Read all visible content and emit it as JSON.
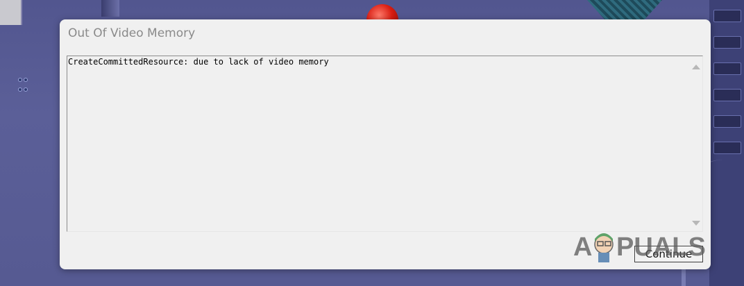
{
  "dialog": {
    "title": "Out Of Video Memory",
    "message": "CreateCommittedResource: due to lack of video memory",
    "continue_label": "Continue"
  },
  "watermark": {
    "text": "APPUALS"
  },
  "colors": {
    "background": "#565a92",
    "dialog_bg": "#f0f0f0",
    "title_text": "#8a8a8a",
    "button_border": "#3c3c3c"
  }
}
